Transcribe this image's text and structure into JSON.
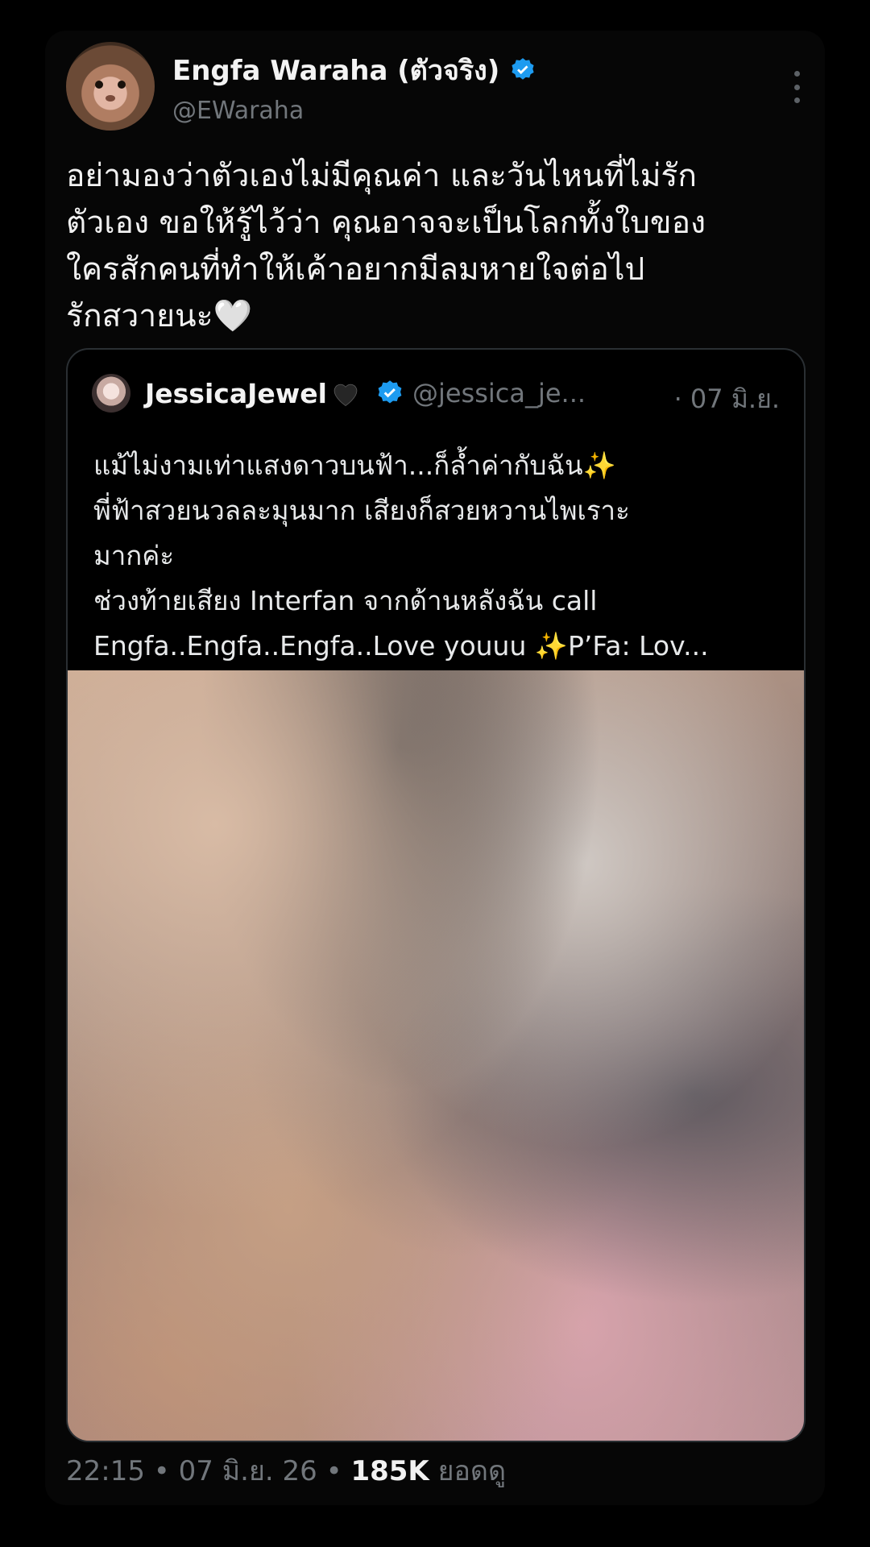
{
  "tweet": {
    "display_name": "Engfa Waraha (ตัวจริง)",
    "handle": "@EWaraha",
    "text": "อย่ามองว่าตัวเองไม่มีคุณค่า และวันไหนที่ไม่รัก\nตัวเอง ขอให้รู้ไว้ว่า คุณอาจจะเป็นโลกทั้งใบของ\nใครสักคนที่ทำให้เค้าอยากมีลมหายใจต่อไป\nรักสวายนะ🤍"
  },
  "quote": {
    "display_name": "JessicaJewel",
    "handle": "@jessica_je...",
    "date": "· 07 มิ.ย.",
    "text": "แม้ไม่งามเท่าแสงดาวบนฟ้า...ก็ล้ำค่ากับฉัน✨\nพี่ฟ้าสวยนวลละมุนมาก เสียงก็สวยหวานไพเราะ\nมากค่ะ\nช่วงท้ายเสียง Interfan จากด้านหลังฉัน call\nEngfa..Engfa..Engfa..Love youuu ✨P’Fa: Lov..."
  },
  "meta": {
    "time": "22:15",
    "date": "07 มิ.ย. 26",
    "views_count": "185K",
    "views_label": "ยอดดู"
  },
  "colors": {
    "background": "#000000",
    "text_primary": "#e7e9ea",
    "text_secondary": "#71767b",
    "verified": "#1d9bf0"
  },
  "icons": {
    "verified": "verified-badge-icon",
    "more": "more-vertical-icon",
    "heart": "black-heart-icon"
  }
}
